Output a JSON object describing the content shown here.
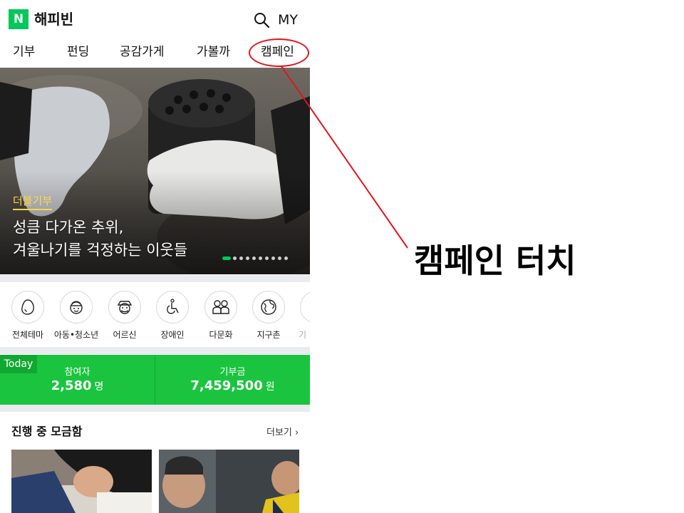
{
  "header": {
    "logo": "N",
    "brand": "해피빈",
    "my_label": "MY",
    "search_icon": "search-icon"
  },
  "tabs": [
    {
      "label": "기부"
    },
    {
      "label": "펀딩"
    },
    {
      "label": "공감가게"
    },
    {
      "label": "가볼까"
    },
    {
      "label": "캠페인"
    }
  ],
  "hero": {
    "tag": "더블기부",
    "title_line1": "성큼 다가온 추위,",
    "title_line2": "겨울나기를 걱정하는 이웃들",
    "slide_count": 10,
    "active_slide": 1
  },
  "categories": [
    {
      "label": "전체테마",
      "icon": "egg-icon"
    },
    {
      "label": "아동•청소년",
      "icon": "child-icon"
    },
    {
      "label": "어르신",
      "icon": "elder-icon"
    },
    {
      "label": "장애인",
      "icon": "wheelchair-icon"
    },
    {
      "label": "다문화",
      "icon": "people-icon"
    },
    {
      "label": "지구촌",
      "icon": "globe-icon"
    },
    {
      "label": "기",
      "icon": "more-category-icon"
    }
  ],
  "stats": {
    "today_label": "Today",
    "participants_label": "참여자",
    "participants_value": "2,580",
    "participants_unit": "명",
    "donations_label": "기부금",
    "donations_value": "7,459,500",
    "donations_unit": "원"
  },
  "section": {
    "title": "진행 중 모금함",
    "more": "더보기 ›"
  },
  "annotation": {
    "text": "캠페인 터치",
    "color": "#e3141b"
  },
  "colors": {
    "brand_green": "#03c75a",
    "stats_green": "#1bc43f",
    "tag_yellow": "#ffd64a"
  }
}
